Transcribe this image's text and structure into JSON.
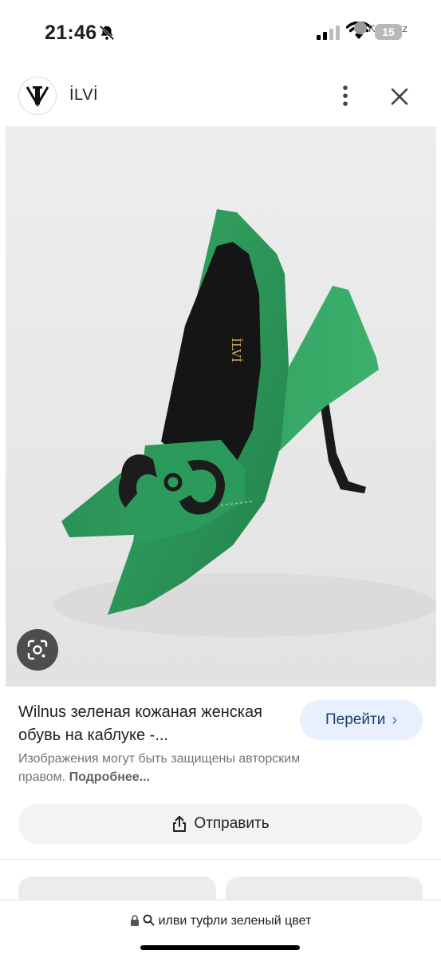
{
  "status_bar": {
    "time": "21:46",
    "back_app": "Kaspi.kz",
    "battery": "15",
    "icons": [
      "bell-off-icon",
      "signal-icon",
      "wifi-icon",
      "battery-icon"
    ]
  },
  "header": {
    "site_name": "İLVİ",
    "logo_icon": "ilvi-logo",
    "more_icon": "more-vert-icon",
    "close_icon": "close-icon"
  },
  "image": {
    "brand_on_insole": "İLVİ",
    "lens_icon": "google-lens-icon",
    "colors": {
      "shoe": "#2e9a5c",
      "shoe_shadow": "#1d7a45",
      "buckle": "#1c1c1c",
      "background": "#e9e9e9"
    }
  },
  "result": {
    "title": "Wilnus зеленая кожаная женская обувь на каблуке -...",
    "visit_label": "Перейти",
    "copyright_text": "Изображения могут быть защищены авторским правом.",
    "more_link": "Подробнее..."
  },
  "share": {
    "label": "Отправить",
    "icon": "share-icon"
  },
  "bottom_bar": {
    "query": "илви туфли зеленый цвет",
    "icons": [
      "lock-icon",
      "search-icon"
    ]
  },
  "colors": {
    "visit_bg": "#e8f0fe",
    "visit_text": "#1f3b73",
    "share_bg": "#f1f3f4"
  }
}
